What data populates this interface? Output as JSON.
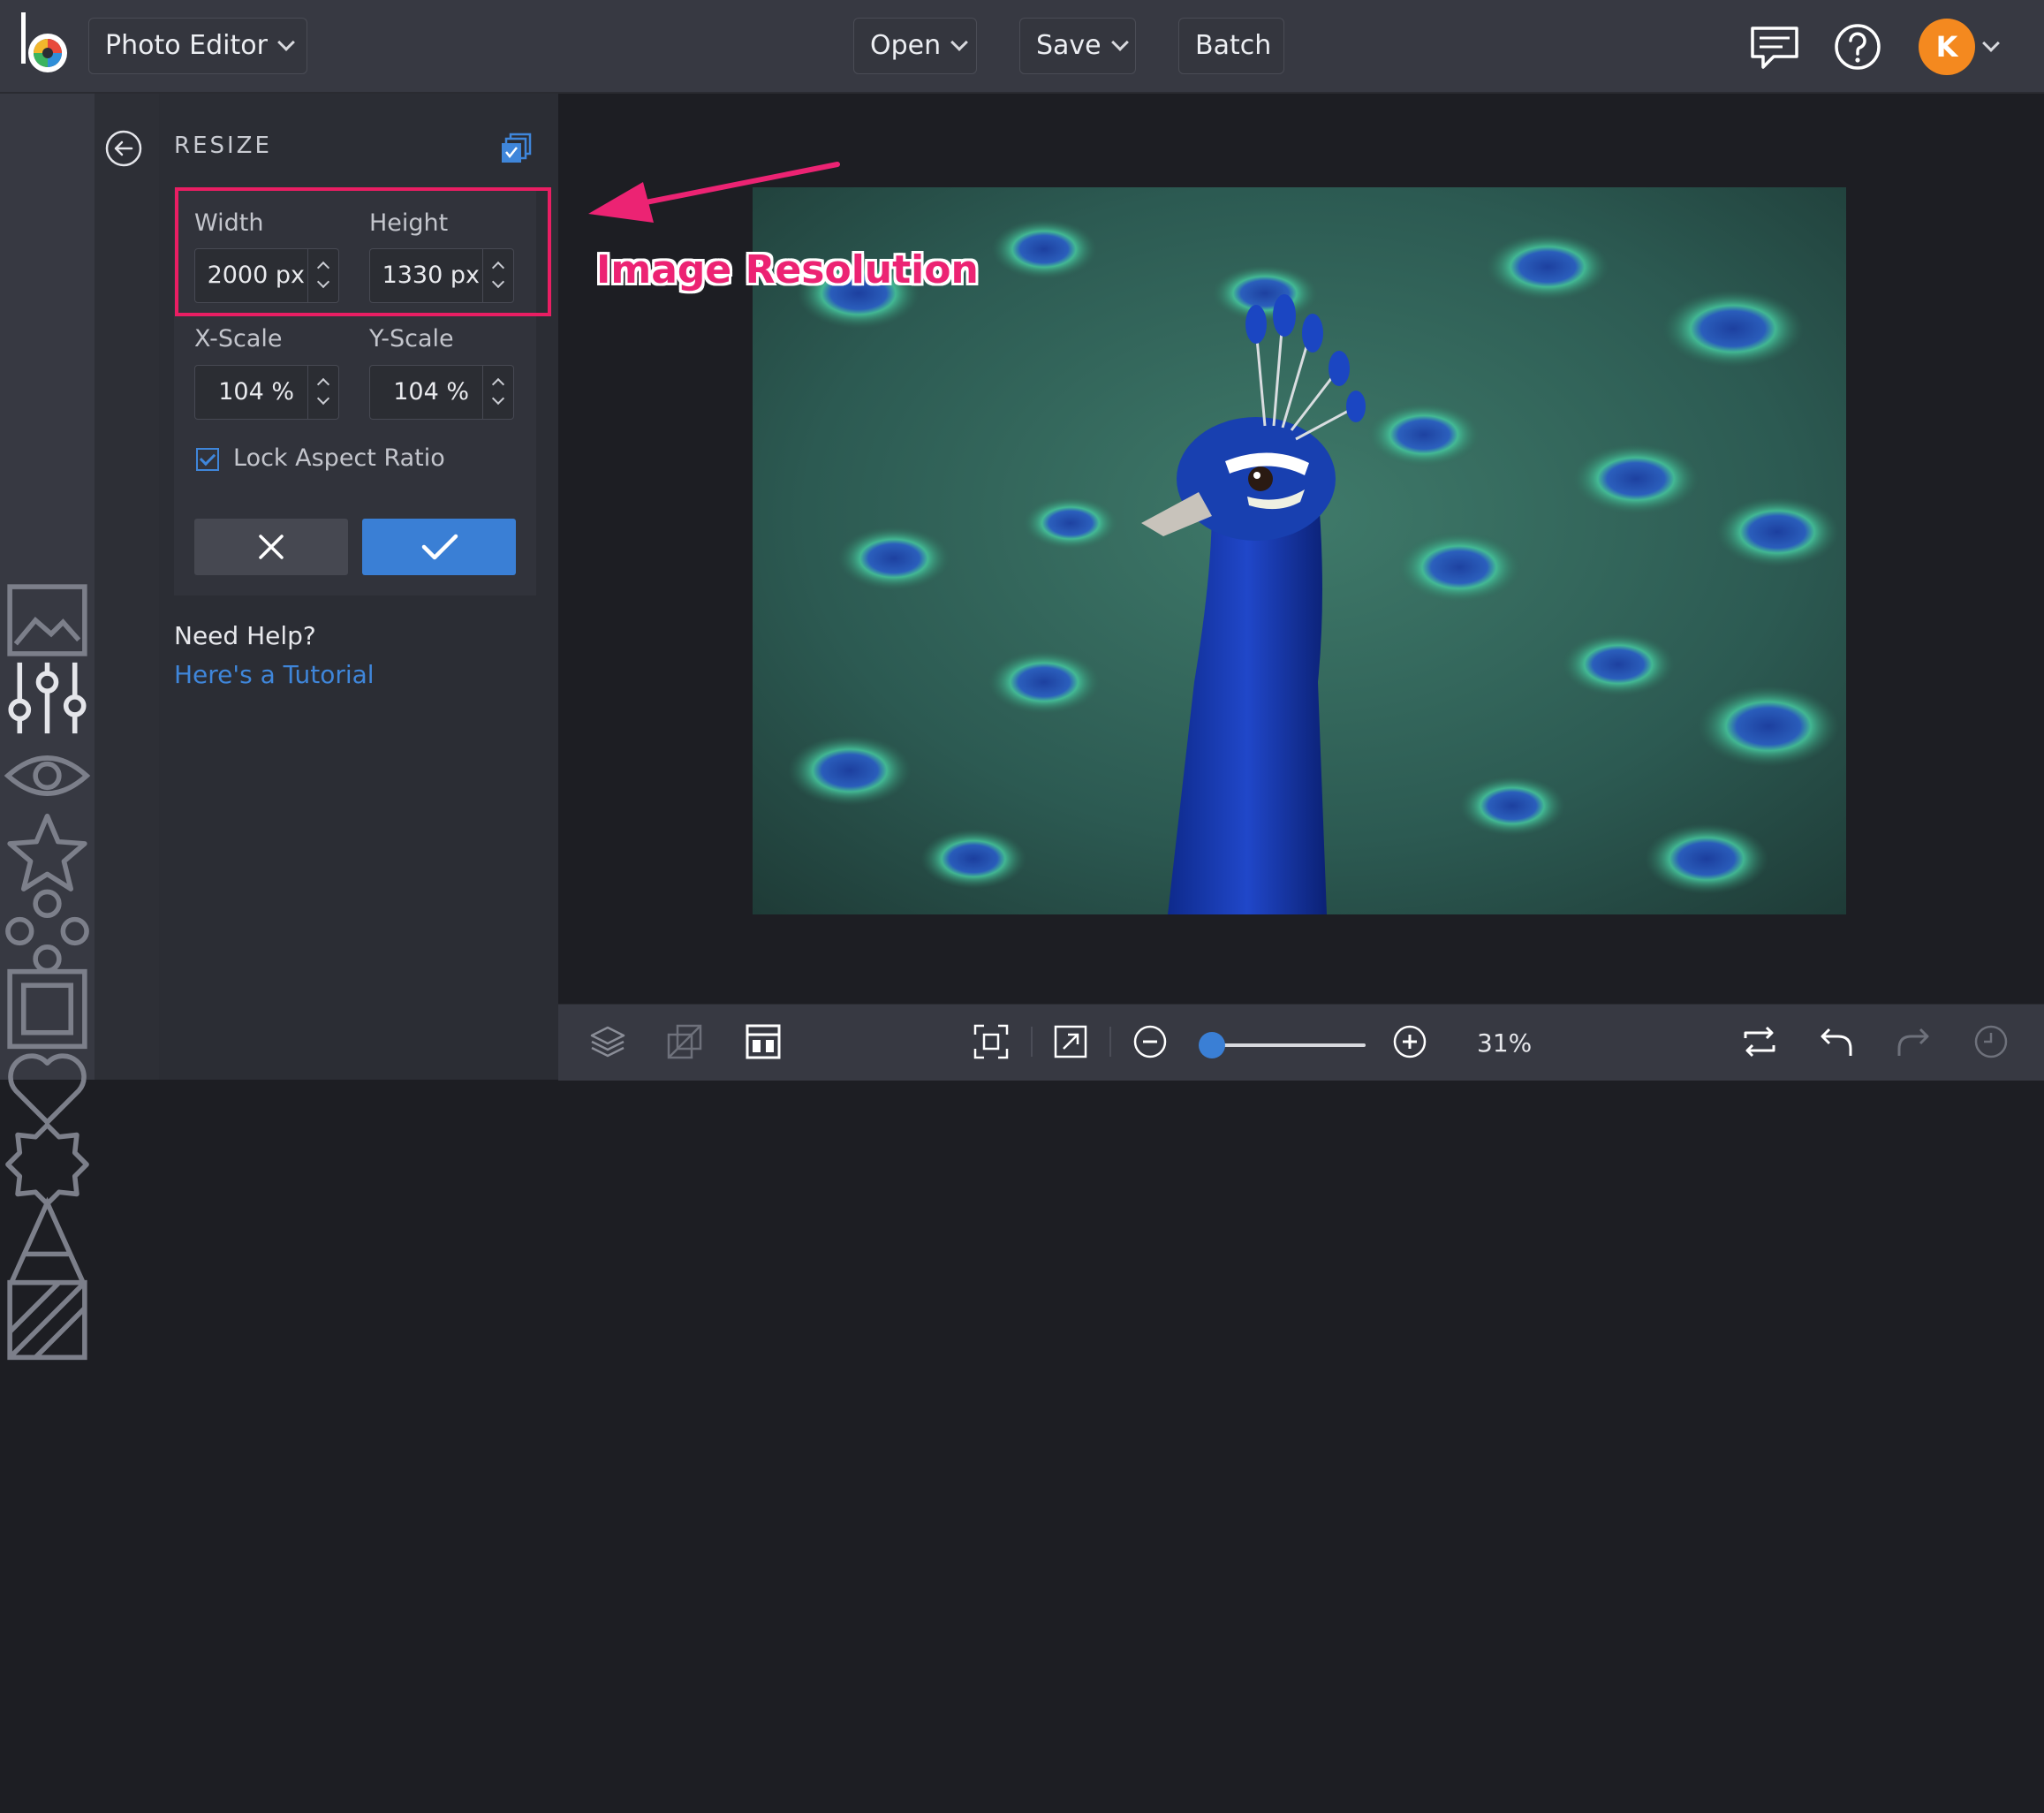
{
  "header": {
    "app_switcher_label": "Photo Editor",
    "open_label": "Open",
    "save_label": "Save",
    "batch_label": "Batch",
    "avatar_initial": "K"
  },
  "icons": {
    "rail": [
      "image-icon",
      "sliders-icon",
      "eye-icon",
      "star-icon",
      "clusters-icon",
      "frame-icon",
      "heart-icon",
      "badge-icon",
      "text-icon",
      "texture-icon"
    ],
    "bottom": [
      "layers-icon",
      "arrange-icon",
      "layout-icon",
      "fit-icon",
      "expand-icon",
      "zoom-out-icon",
      "zoom-in-icon",
      "swap-icon",
      "undo-icon",
      "redo-icon",
      "history-icon"
    ]
  },
  "panel": {
    "title": "RESIZE",
    "width_label": "Width",
    "height_label": "Height",
    "width_value": "2000 px",
    "height_value": "1330 px",
    "xscale_label": "X-Scale",
    "yscale_label": "Y-Scale",
    "xscale_value": "104 %",
    "yscale_value": "104 %",
    "lock_label": "Lock Aspect Ratio",
    "lock_checked": true,
    "help_title": "Need Help?",
    "help_link": "Here's a Tutorial"
  },
  "annotation": {
    "text": "Image Resolution"
  },
  "zoom": {
    "label": "31%",
    "level": 0.31
  },
  "colors": {
    "accent": "#3a7fd5",
    "highlight": "#e91e63",
    "avatar": "#f4891f"
  }
}
